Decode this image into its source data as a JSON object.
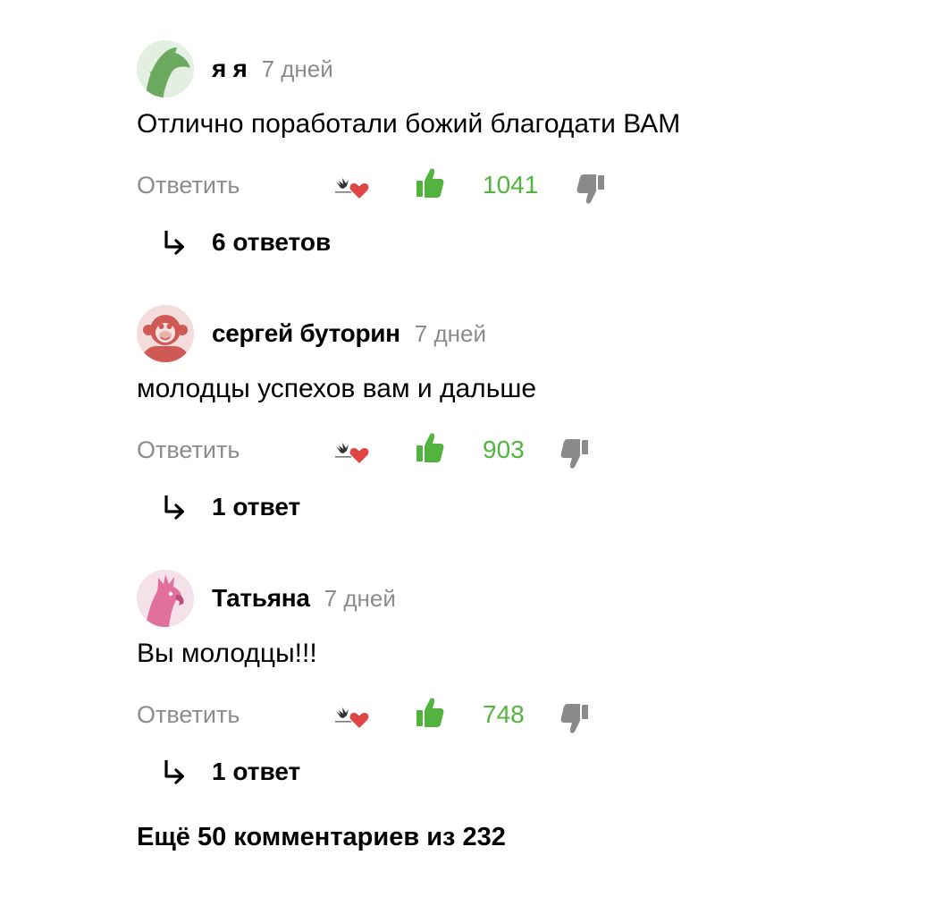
{
  "colors": {
    "like": "#52b33e",
    "muted": "#8c8c8c",
    "dislike": "#8a8a8a",
    "heart": "#e04545"
  },
  "comments": [
    {
      "author": "я я",
      "time": "7 дней",
      "text": "Отлично поработали божий благодати ВАМ",
      "reply_label": "Ответить",
      "likes": "1041",
      "replies_label": "6 ответов",
      "avatar_icon": "dolphin-icon",
      "avatar_bg": "#e3efe0",
      "avatar_fg": "#6aa95e"
    },
    {
      "author": "сергей буторин",
      "time": "7 дней",
      "text": "молодцы успехов вам и дальше",
      "reply_label": "Ответить",
      "likes": "903",
      "replies_label": "1 ответ",
      "avatar_icon": "monkey-icon",
      "avatar_bg": "#f3dcdb",
      "avatar_fg": "#cf5a55"
    },
    {
      "author": "Татьяна",
      "time": "7 дней",
      "text": "Вы молодцы!!!",
      "reply_label": "Ответить",
      "likes": "748",
      "replies_label": "1 ответ",
      "avatar_icon": "parrot-icon",
      "avatar_bg": "#f5e1ea",
      "avatar_fg": "#e2709d"
    }
  ],
  "more_comments": "Ещё 50 комментариев из 232"
}
